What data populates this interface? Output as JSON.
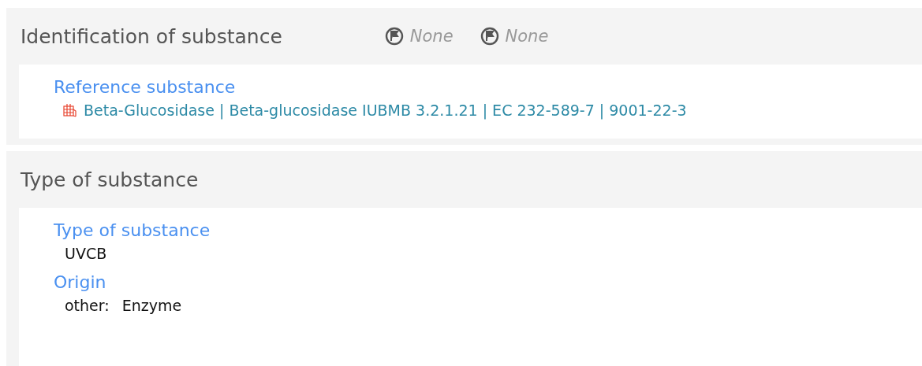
{
  "sections": [
    {
      "title": "Identification of substance",
      "flags": [
        "None",
        "None"
      ],
      "fields": [
        {
          "kind": "reference",
          "label": "Reference substance",
          "value": "Beta-Glucosidase | Beta-glucosidase IUBMB 3.2.1.21 | EC 232-589-7 | 9001-22-3"
        }
      ]
    },
    {
      "title": "Type of substance",
      "fields": [
        {
          "kind": "text",
          "label": "Type of substance",
          "value": "UVCB"
        },
        {
          "kind": "pair",
          "label": "Origin",
          "prefix": "other:",
          "value": "Enzyme"
        }
      ]
    }
  ]
}
